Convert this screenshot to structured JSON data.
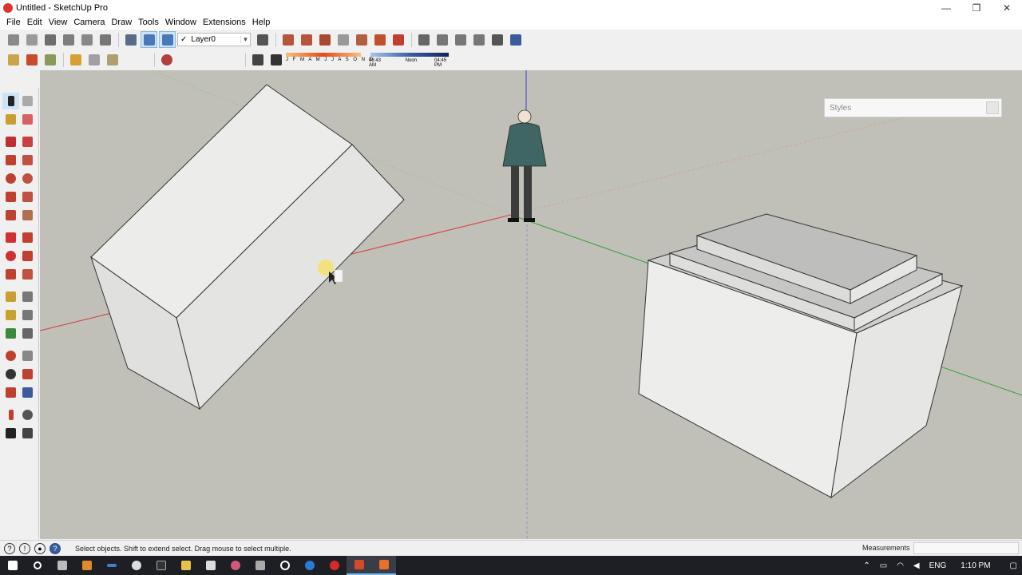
{
  "window": {
    "title": "Untitled - SketchUp Pro",
    "minimize": "—",
    "maximize": "❐",
    "close": "✕"
  },
  "menu": [
    "File",
    "Edit",
    "View",
    "Camera",
    "Draw",
    "Tools",
    "Window",
    "Extensions",
    "Help"
  ],
  "toolbar": {
    "layer_value": "Layer0",
    "layer_check": "✓",
    "months": "J F M A M J J A S O N D",
    "time_start": "06:43 AM",
    "time_noon": "Noon",
    "time_end": "04:45 PM"
  },
  "styles_panel": {
    "title": "Styles"
  },
  "status": {
    "hint": "Select objects. Shift to extend select. Drag mouse to select multiple.",
    "measurements_label": "Measurements"
  },
  "taskbar": {
    "lang": "ENG",
    "clock": "1:10 PM"
  },
  "colors": {
    "viewport_bg": "#c0c0b8",
    "red_axis": "#d43a3a",
    "green_axis": "#3aa03a",
    "blue_axis": "#3a3ad4",
    "face_light": "#ececea",
    "face_mid": "#d8d8d6",
    "face_dark": "#bdbdbb"
  }
}
